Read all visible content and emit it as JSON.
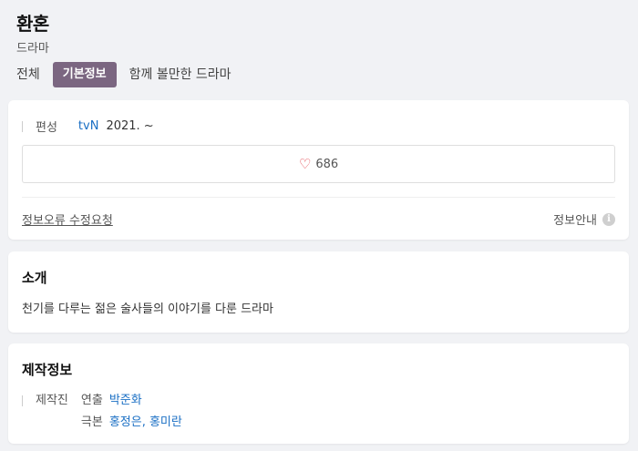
{
  "header": {
    "title": "환혼",
    "subtitle": "드라마",
    "tabs": [
      {
        "label": "전체"
      },
      {
        "label": "기본정보"
      },
      {
        "label": "함께 볼만한 드라마"
      }
    ]
  },
  "basic_info": {
    "broadcast_label": "편성",
    "channel": "tvN",
    "date": "2021. ~",
    "like_count": "686",
    "error_report": "정보오류 수정요청",
    "info_guide": "정보안내"
  },
  "intro": {
    "title": "소개",
    "text": "천기를 다루는 젊은 술사들의 이야기를 다룬 드라마"
  },
  "production": {
    "title": "제작정보",
    "label": "제작진",
    "roles": [
      {
        "role": "연출",
        "names": "박준화"
      },
      {
        "role": "극본",
        "names": "홍정은, 홍미란"
      }
    ]
  },
  "colors": {
    "accent": "#7b6681",
    "link": "#1a6fc4",
    "heart": "#e2434c"
  }
}
